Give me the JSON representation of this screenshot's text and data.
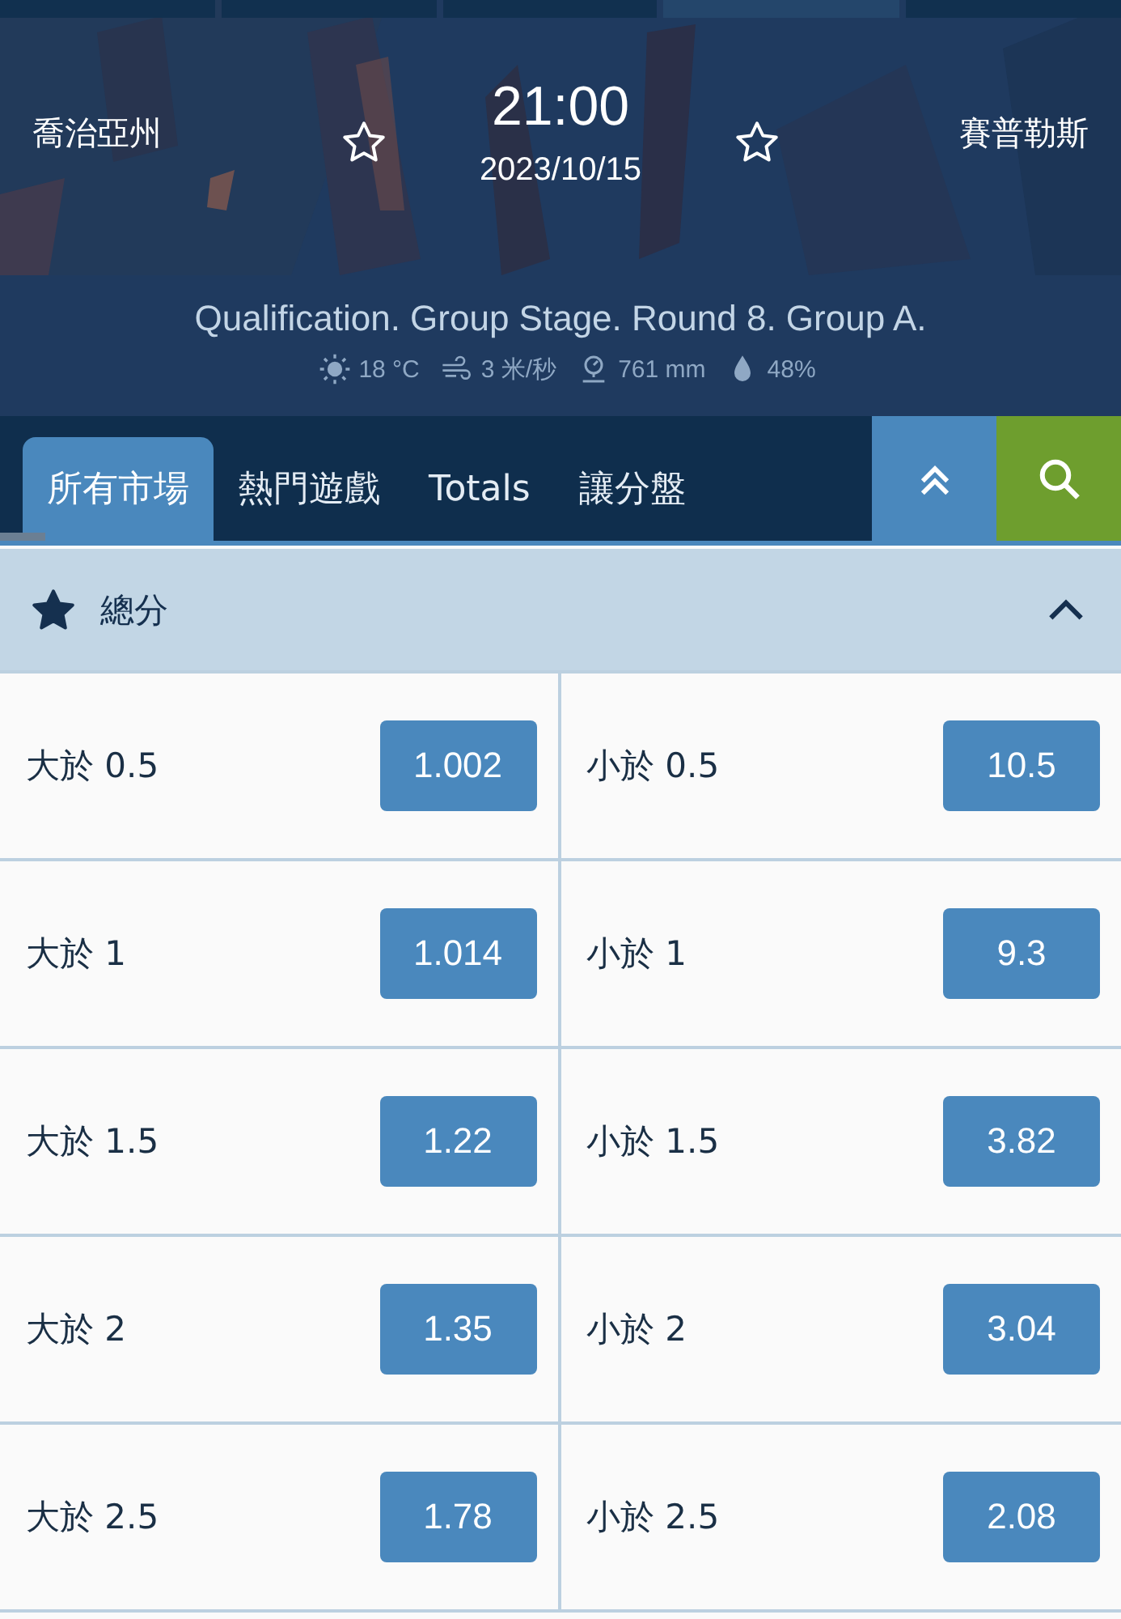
{
  "match": {
    "home": "喬治亞州",
    "away": "賽普勒斯",
    "time": "21:00",
    "date": "2023/10/15",
    "home_favorite": false,
    "away_favorite": false,
    "competition": "Qualification. Group Stage. Round 8. Group A.",
    "weather": {
      "temperature": "18 °C",
      "wind": "3 米/秒",
      "pressure": "761 mm",
      "humidity": "48%"
    }
  },
  "tabs": [
    {
      "label": "所有市場",
      "selected": true
    },
    {
      "label": "熱門遊戲",
      "selected": false
    },
    {
      "label": "Totals",
      "selected": false
    },
    {
      "label": "讓分盤",
      "selected": false
    }
  ],
  "market": {
    "title": "總分",
    "favorite": true,
    "expanded": true,
    "rows": [
      {
        "over": {
          "label": "大於 0.5",
          "odds": "1.002"
        },
        "under": {
          "label": "小於 0.5",
          "odds": "10.5"
        }
      },
      {
        "over": {
          "label": "大於 1",
          "odds": "1.014"
        },
        "under": {
          "label": "小於 1",
          "odds": "9.3"
        }
      },
      {
        "over": {
          "label": "大於 1.5",
          "odds": "1.22"
        },
        "under": {
          "label": "小於 1.5",
          "odds": "3.82"
        }
      },
      {
        "over": {
          "label": "大於 2",
          "odds": "1.35"
        },
        "under": {
          "label": "小於 2",
          "odds": "3.04"
        }
      },
      {
        "over": {
          "label": "大於 2.5",
          "odds": "1.78"
        },
        "under": {
          "label": "小於 2.5",
          "odds": "2.08"
        }
      }
    ]
  }
}
